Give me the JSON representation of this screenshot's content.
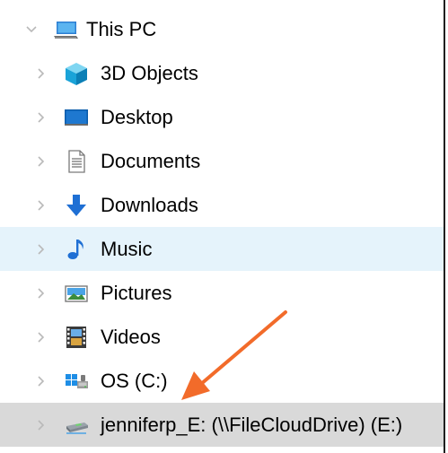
{
  "tree": {
    "root": {
      "label": "This PC",
      "icon": "computer-icon",
      "expanded": true
    },
    "items": [
      {
        "label": "3D Objects",
        "icon": "cube-3d-icon"
      },
      {
        "label": "Desktop",
        "icon": "desktop-icon"
      },
      {
        "label": "Documents",
        "icon": "document-icon"
      },
      {
        "label": "Downloads",
        "icon": "download-arrow-icon"
      },
      {
        "label": "Music",
        "icon": "music-note-icon",
        "state": "hover"
      },
      {
        "label": "Pictures",
        "icon": "pictures-icon"
      },
      {
        "label": "Videos",
        "icon": "film-icon"
      },
      {
        "label": "OS (C:)",
        "icon": "windows-drive-icon"
      },
      {
        "label": "jenniferp_E: (\\\\FileCloudDrive) (E:)",
        "icon": "network-drive-icon",
        "state": "selected"
      }
    ]
  },
  "colors": {
    "hover_bg": "#e5f3fb",
    "selected_bg": "#d9d9d9",
    "annotation_arrow": "#f26b2a",
    "chevron": "#b9b9b9"
  },
  "annotation": {
    "type": "arrow",
    "points_to": "jenniferp_E: (\\\\FileCloudDrive) (E:)"
  }
}
